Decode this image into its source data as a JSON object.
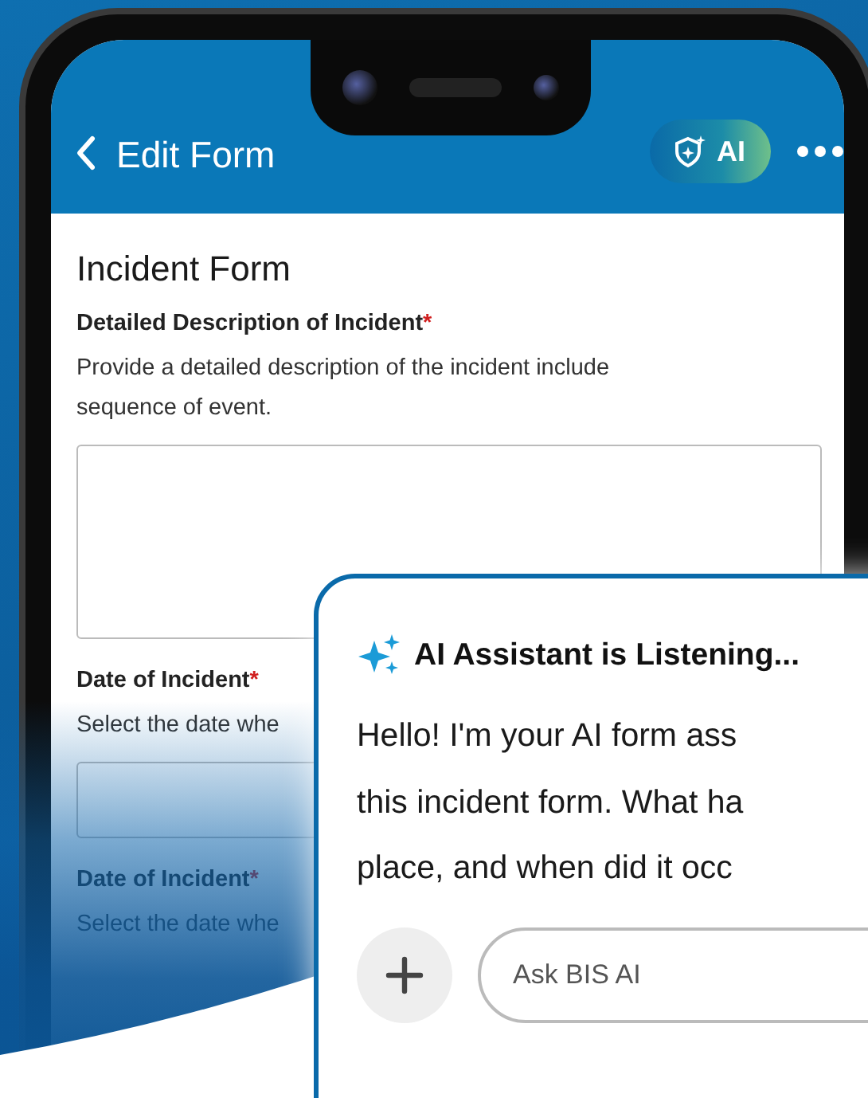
{
  "header": {
    "title": "Edit Form",
    "ai_button": "AI"
  },
  "form": {
    "title": "Incident Form",
    "fields": [
      {
        "kind": "textarea",
        "label": "Detailed Description of Incident",
        "required_mark": "*",
        "hint": "Provide a detailed description of the incident include sequence of event."
      },
      {
        "kind": "input",
        "label": "Date of Incident",
        "required_mark": "*",
        "hint": "Select the date whe"
      },
      {
        "kind": "text",
        "label": "Date of Incident",
        "required_mark": "*",
        "hint": "Select the date whe"
      }
    ]
  },
  "assistant": {
    "title": "AI Assistant is Listening...",
    "message_lines": [
      "Hello! I'm your AI form ass",
      "this incident form. What ha",
      "place, and when did it occ"
    ],
    "input": {
      "placeholder": "Ask BIS AI"
    }
  }
}
